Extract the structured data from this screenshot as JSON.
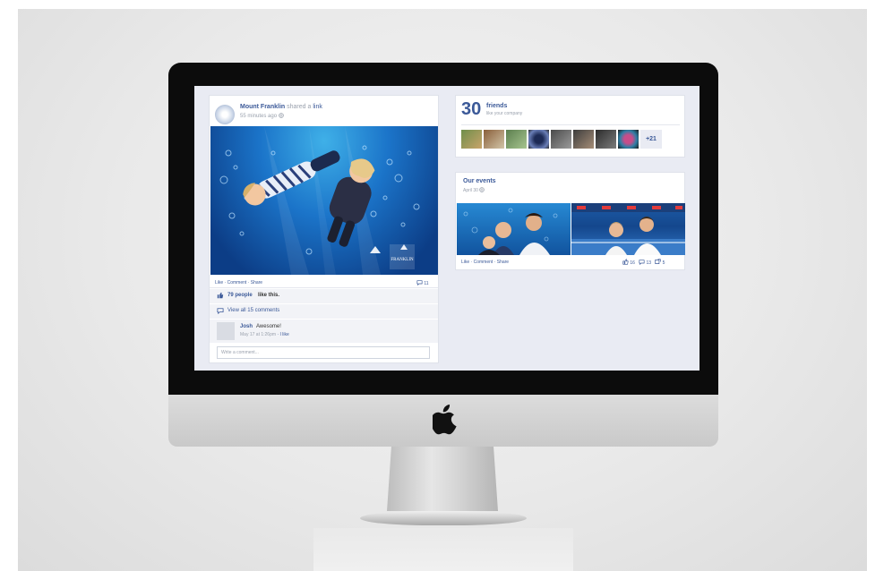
{
  "post": {
    "author": "Mount Franklin",
    "action": "shared a",
    "object": "link",
    "time": "55 minutes ago",
    "actions": "Like · Comment · Share",
    "comment_count": "11",
    "likes_count": "79 people",
    "likes_suffix": "like this.",
    "view_comments": "View all 15 comments",
    "comment": {
      "author": "Josh",
      "text": "Awesome!",
      "time": "May 17 at 1:26pm",
      "like": "· I like"
    },
    "write_placeholder": "Write a comment..."
  },
  "friends": {
    "count": "30",
    "label": "friends",
    "sub": "like your company",
    "more": "+21"
  },
  "events": {
    "title": "Our events",
    "date": "April 30",
    "actions": "Like · Comment · Share",
    "likes": "16",
    "comments": "13",
    "shares": "5"
  },
  "colors": {
    "fb_blue": "#3b5998",
    "screen_bg": "#e9ebf3",
    "water": "#1b74c9"
  }
}
